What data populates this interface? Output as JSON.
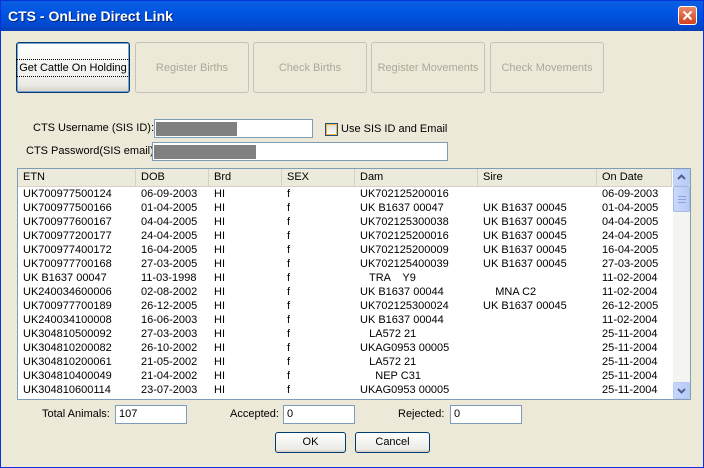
{
  "window": {
    "title": "CTS - OnLine Direct Link"
  },
  "toolbar": {
    "buttons": [
      {
        "label": "Get Cattle On Holding"
      },
      {
        "label": "Register Births"
      },
      {
        "label": "Check Births"
      },
      {
        "label": "Register Movements"
      },
      {
        "label": "Check Movements"
      }
    ]
  },
  "form": {
    "username_label": "CTS Username (SIS ID):",
    "password_label": "CTS Password(SIS email):",
    "use_sis_label": "Use SIS ID and Email"
  },
  "table": {
    "columns": [
      "ETN",
      "DOB",
      "Brd",
      "SEX",
      "Dam",
      "Sire",
      "On Date"
    ],
    "rows": [
      [
        "UK700977500124",
        "06-09-2003",
        "HI",
        "f",
        "UK702125200016",
        "",
        "06-09-2003"
      ],
      [
        "UK700977500166",
        "01-04-2005",
        "HI",
        "f",
        "UK B1637 00047",
        "UK B1637 00045",
        "01-04-2005"
      ],
      [
        "UK700977600167",
        "04-04-2005",
        "HI",
        "f",
        "UK702125300038",
        "UK B1637 00045",
        "04-04-2005"
      ],
      [
        "UK700977200177",
        "24-04-2005",
        "HI",
        "f",
        "UK702125200016",
        "UK B1637 00045",
        "24-04-2005"
      ],
      [
        "UK700977400172",
        "16-04-2005",
        "HI",
        "f",
        "UK702125200009",
        "UK B1637 00045",
        "16-04-2005"
      ],
      [
        "UK700977700168",
        "27-03-2005",
        "HI",
        "f",
        "UK702125400039",
        "UK B1637 00045",
        "27-03-2005"
      ],
      [
        "UK B1637 00047",
        "11-03-1998",
        "HI",
        "f",
        "   TRA    Y9",
        "",
        "11-02-2004"
      ],
      [
        "UK240034600006",
        "02-08-2002",
        "HI",
        "f",
        "UK B1637 00044",
        "    MNA C2",
        "11-02-2004"
      ],
      [
        "UK700977700189",
        "26-12-2005",
        "HI",
        "f",
        "UK702125300024",
        "UK B1637 00045",
        "26-12-2005"
      ],
      [
        "UK240034100008",
        "16-06-2003",
        "HI",
        "f",
        "UK B1637 00044",
        "",
        "11-02-2004"
      ],
      [
        "UK304810500092",
        "27-03-2003",
        "HI",
        "f",
        "   LA572 21",
        "",
        "25-11-2004"
      ],
      [
        "UK304810200082",
        "26-10-2002",
        "HI",
        "f",
        "UKAG0953 00005",
        "",
        "25-11-2004"
      ],
      [
        "UK304810200061",
        "21-05-2002",
        "HI",
        "f",
        "   LA572 21",
        "",
        "25-11-2004"
      ],
      [
        "UK304810400049",
        "21-04-2002",
        "HI",
        "f",
        "     NEP C31",
        "",
        "25-11-2004"
      ],
      [
        "UK304810600114",
        "23-07-2003",
        "HI",
        "f",
        "UKAG0953 00005",
        "",
        "25-11-2004"
      ]
    ]
  },
  "totals": {
    "total_label": "Total Animals:",
    "total_value": "107",
    "accepted_label": "Accepted:",
    "accepted_value": "0",
    "rejected_label": "Rejected:",
    "rejected_value": "0"
  },
  "buttons": {
    "ok": "OK",
    "cancel": "Cancel"
  }
}
